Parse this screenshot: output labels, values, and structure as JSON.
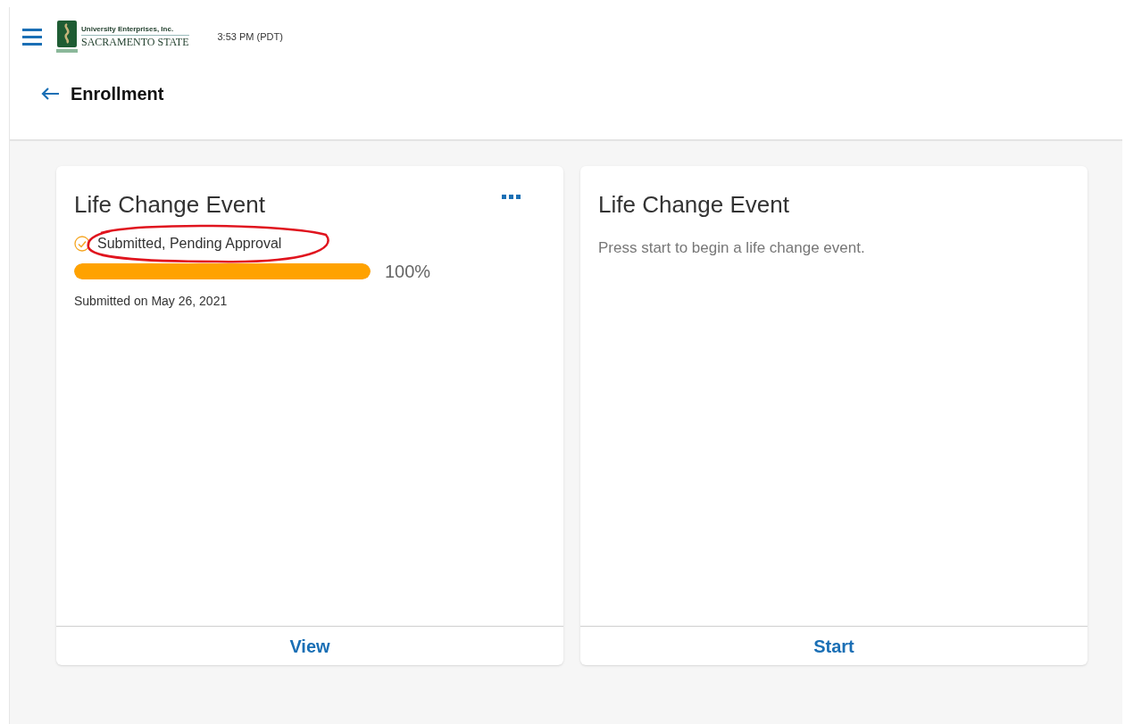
{
  "header": {
    "logo": {
      "line_1": "University Enterprises, Inc.",
      "line_2": "SACRAMENTO STATE"
    },
    "time": "3:53 PM (PDT)"
  },
  "page_title": "Enrollment",
  "cards": [
    {
      "kind": "progress",
      "title": "Life Change Event",
      "status": "Submitted, Pending Approval",
      "level": 1,
      "percent": "100%",
      "note": "Submitted on May 26, 2021",
      "action": "View",
      "annotated": true
    },
    {
      "kind": "prompt",
      "title": "Life Change Event",
      "text": "Press start to begin a life change event.",
      "action": "Start"
    }
  ]
}
